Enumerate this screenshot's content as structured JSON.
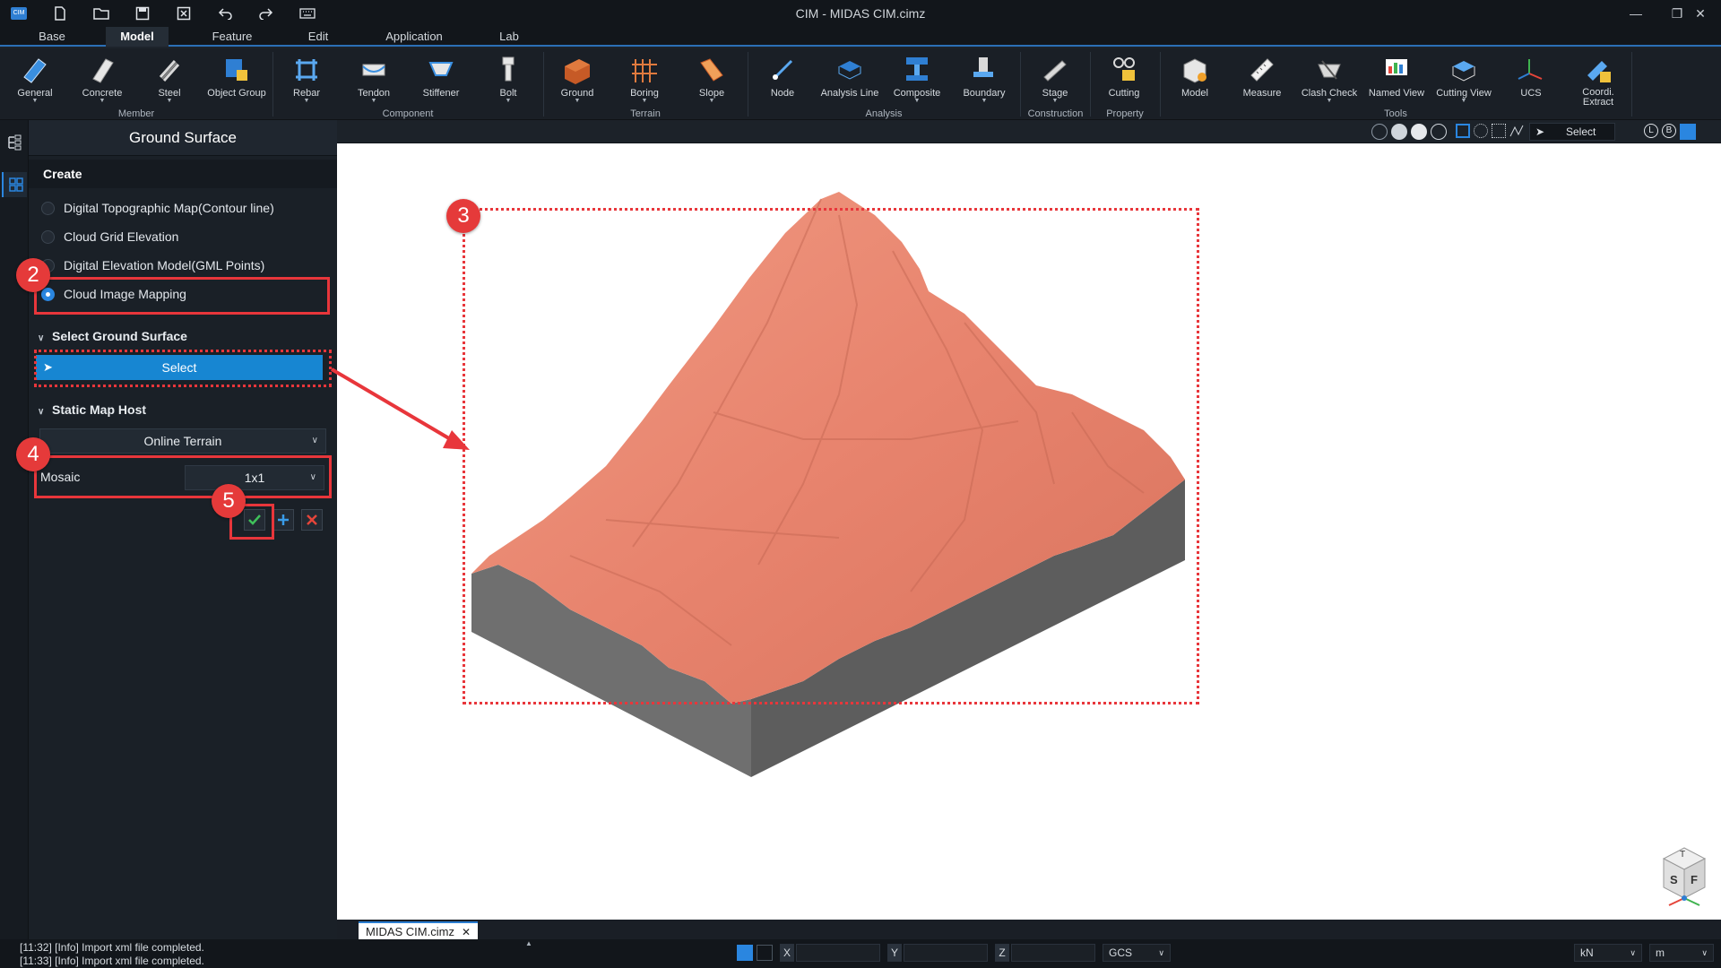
{
  "window": {
    "title": "CIM - MIDAS CIM.cimz",
    "app_icon_text": "CIM"
  },
  "quick_access": [
    "new-file-icon",
    "open-folder-icon",
    "save-icon",
    "close-file-icon",
    "undo-icon",
    "redo-icon",
    "keyboard-icon"
  ],
  "menu_tabs": [
    {
      "label": "Base"
    },
    {
      "label": "Model",
      "active": true
    },
    {
      "label": "Feature"
    },
    {
      "label": "Edit"
    },
    {
      "label": "Application"
    },
    {
      "label": "Lab"
    }
  ],
  "ribbon": {
    "buttons": [
      {
        "label": "General",
        "icon": "general-member-icon"
      },
      {
        "label": "Concrete",
        "icon": "concrete-icon"
      },
      {
        "label": "Steel",
        "icon": "steel-icon"
      },
      {
        "label": "Object Group",
        "icon": "object-group-icon"
      },
      {
        "label": "Rebar",
        "icon": "rebar-icon"
      },
      {
        "label": "Tendon",
        "icon": "tendon-icon"
      },
      {
        "label": "Stiffener",
        "icon": "stiffener-icon"
      },
      {
        "label": "Bolt",
        "icon": "bolt-icon"
      },
      {
        "label": "Ground",
        "icon": "ground-icon"
      },
      {
        "label": "Boring",
        "icon": "boring-icon"
      },
      {
        "label": "Slope",
        "icon": "slope-icon"
      },
      {
        "label": "Node",
        "icon": "node-icon"
      },
      {
        "label": "Analysis Line",
        "icon": "analysis-line-icon"
      },
      {
        "label": "Composite",
        "icon": "composite-icon"
      },
      {
        "label": "Boundary",
        "icon": "boundary-icon"
      },
      {
        "label": "Stage",
        "icon": "stage-icon"
      },
      {
        "label": "Cutting",
        "icon": "cutting-icon"
      },
      {
        "label": "Model",
        "icon": "model-property-icon"
      },
      {
        "label": "Measure",
        "icon": "measure-icon"
      },
      {
        "label": "Clash Check",
        "icon": "clash-check-icon"
      },
      {
        "label": "Named View",
        "icon": "named-view-icon"
      },
      {
        "label": "Cutting View",
        "icon": "cutting-view-icon"
      },
      {
        "label": "UCS",
        "icon": "ucs-icon"
      },
      {
        "label": "Coordi. Extract",
        "icon": "coordinate-extract-icon"
      }
    ],
    "groups": [
      "Member",
      "Component",
      "Terrain",
      "Analysis",
      "Construction",
      "Property",
      "Tools"
    ]
  },
  "panel": {
    "title": "Ground Surface",
    "create_header": "Create",
    "options": [
      {
        "label": "Digital Topographic Map(Contour line)",
        "selected": false
      },
      {
        "label": "Cloud Grid Elevation",
        "selected": false
      },
      {
        "label": "Digital Elevation Model(GML Points)",
        "selected": false
      },
      {
        "label": "Cloud Image Mapping",
        "selected": true
      }
    ],
    "select_section": "Select Ground Surface",
    "select_button": "Select",
    "static_map_section": "Static Map Host",
    "host_value": "Online Terrain",
    "mosaic_label": "Mosaic",
    "mosaic_value": "1x1"
  },
  "annotations": {
    "badges": [
      "2",
      "3",
      "4",
      "5"
    ]
  },
  "viewport_toolbar": {
    "select_label": "Select"
  },
  "document_tab": "MIDAS CIM.cimz",
  "status": {
    "log": [
      "[11:32] [Info] Import xml file completed.",
      "[11:33] [Info] Import xml file completed."
    ],
    "coord_x_label": "X",
    "coord_y_label": "Y",
    "coord_z_label": "Z",
    "coord_system": "GCS",
    "force_unit": "kN",
    "length_unit": "m"
  },
  "colors": {
    "accent": "#1786d2",
    "annotation": "#e8363b",
    "terrain": "#e8846e",
    "terrain_side": "#6b6b6b"
  },
  "view_cube": {
    "top": "T",
    "front": "F",
    "side": "S"
  }
}
